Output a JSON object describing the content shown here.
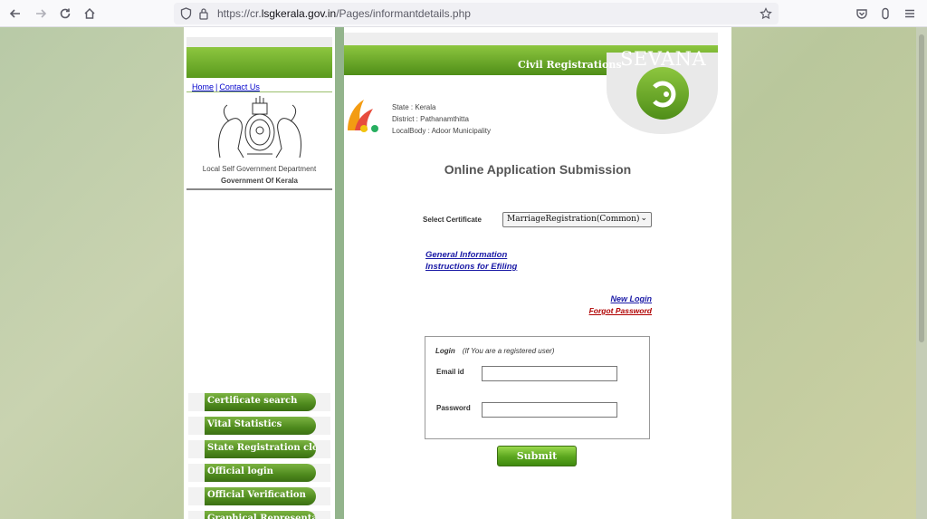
{
  "browser": {
    "url_prefix": "https://cr.",
    "url_host": "lsgkerala.gov.in",
    "url_path": "/Pages/informantdetails.php"
  },
  "sidebar": {
    "links": [
      "Home",
      "Contact Us"
    ],
    "department": "Local Self Government Department",
    "government": "Government Of Kerala",
    "menu": [
      "Certificate search",
      "Vital Statistics",
      "State Registration clock",
      "Official login",
      "Official Verification",
      "Graphical Representation"
    ]
  },
  "header": {
    "civil": "Civil Registrations",
    "brand": "SEVANA",
    "state": "State : Kerala",
    "district": "District : Pathanamthitta",
    "localbody": "LocalBody : Adoor Municipality"
  },
  "main": {
    "title": "Online Application Submission",
    "select_label": "Select Certificate",
    "select_value": "MarriageRegistration(Common)",
    "general_info": "General Information",
    "instructions": "Instructions for Efiling",
    "new_login": "New Login",
    "forgot_password": "Forgot Password"
  },
  "login": {
    "heading": "Login",
    "note": "(If You are a registered user)",
    "email_label": "Email id",
    "password_label": "Password",
    "email_value": "",
    "password_value": "",
    "submit_label": "Submit"
  },
  "colors": {
    "brand_green": "#5a9a1e",
    "link_blue": "#1a1aa6",
    "forgot_red": "#b00000"
  }
}
